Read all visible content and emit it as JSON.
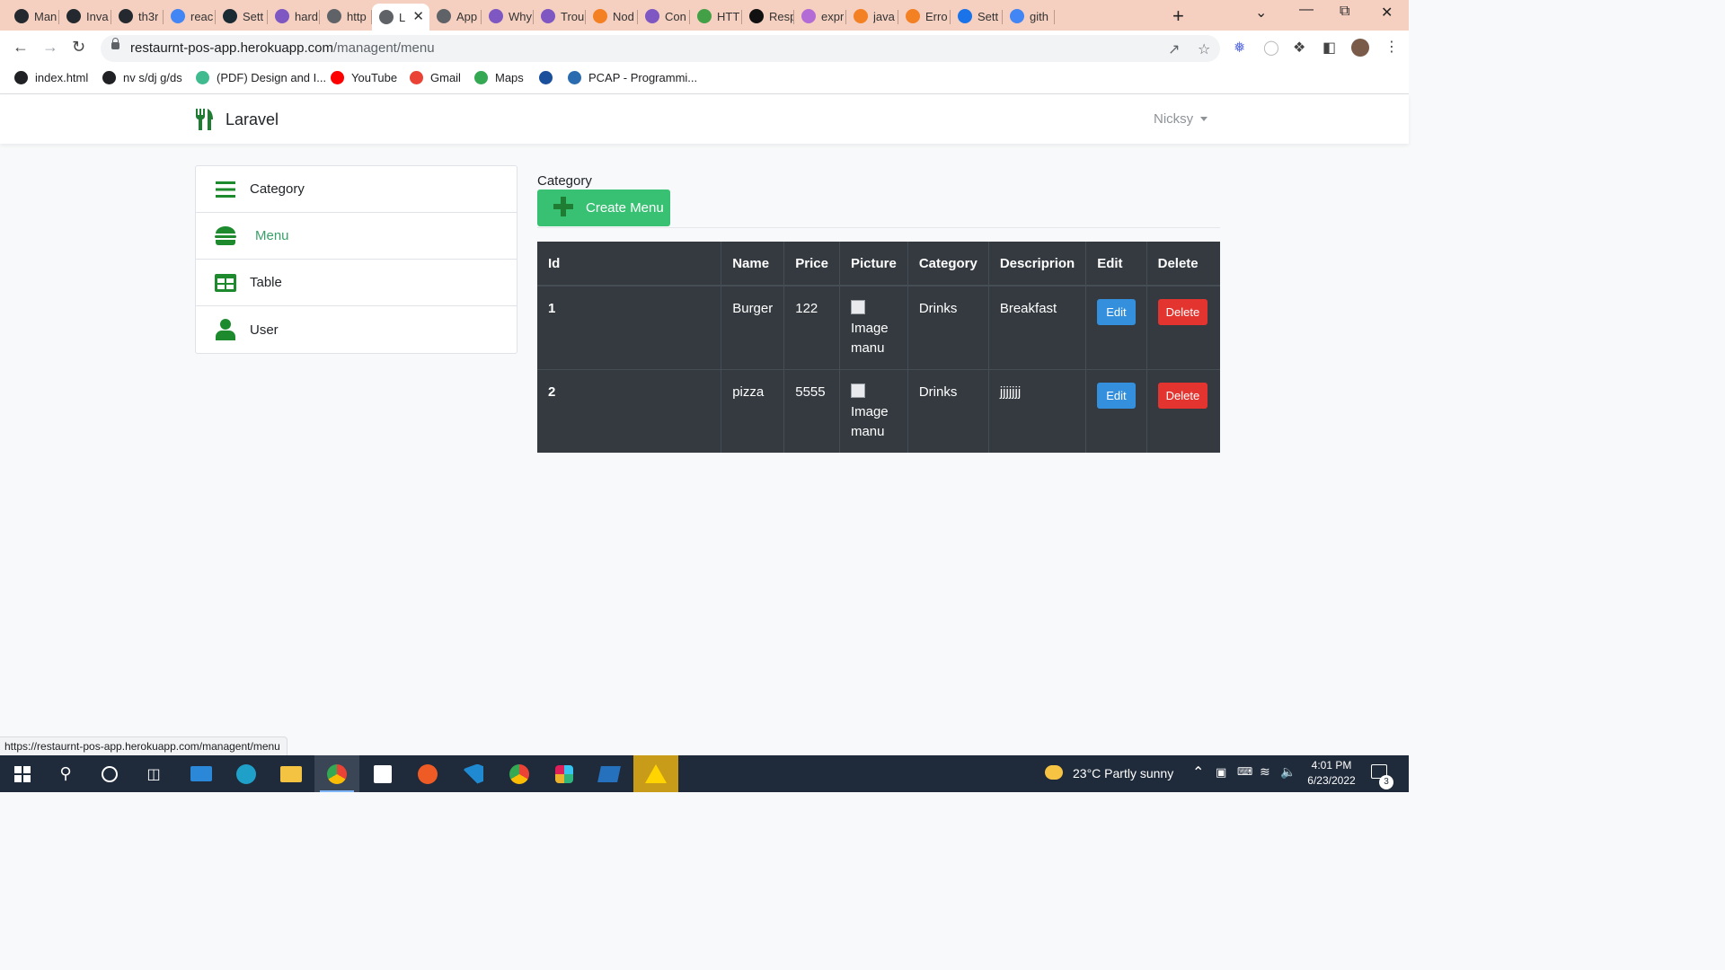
{
  "browser": {
    "tabs": [
      {
        "title": "Man",
        "icon": "github-icon",
        "color": "#24292f"
      },
      {
        "title": "Inva",
        "icon": "github-icon",
        "color": "#24292f"
      },
      {
        "title": "th3r",
        "icon": "github-icon",
        "color": "#24292f"
      },
      {
        "title": "reac",
        "icon": "google-icon",
        "color": "#4285f4"
      },
      {
        "title": "Sett",
        "icon": "react-icon",
        "color": "#1b2b34"
      },
      {
        "title": "hard",
        "icon": "hashnode-icon",
        "color": "#7e57c2"
      },
      {
        "title": "http",
        "icon": "globe-icon",
        "color": "#5f6368"
      },
      {
        "title": "L",
        "icon": "globe-icon",
        "color": "#5f6368",
        "active": true
      },
      {
        "title": "App",
        "icon": "globe-icon",
        "color": "#5f6368"
      },
      {
        "title": "Why",
        "icon": "hashnode-icon",
        "color": "#7e57c2"
      },
      {
        "title": "Trou",
        "icon": "hashnode-icon",
        "color": "#7e57c2"
      },
      {
        "title": "Nod",
        "icon": "stackoverflow-icon",
        "color": "#f48024"
      },
      {
        "title": "Con",
        "icon": "hashnode-icon",
        "color": "#7e57c2"
      },
      {
        "title": "HTT",
        "icon": "node-icon",
        "color": "#43a047"
      },
      {
        "title": "Resp",
        "icon": "medium-icon",
        "color": "#111111"
      },
      {
        "title": "expr",
        "icon": "graphql-icon",
        "color": "#b36bd6"
      },
      {
        "title": "java",
        "icon": "stackoverflow-icon",
        "color": "#f48024"
      },
      {
        "title": "Erro",
        "icon": "stackoverflow-icon",
        "color": "#f48024"
      },
      {
        "title": "Sett",
        "icon": "gear-icon",
        "color": "#1a73e8"
      },
      {
        "title": "gith",
        "icon": "google-icon",
        "color": "#4285f4"
      }
    ],
    "url_host": "restaurnt-pos-app.herokuapp.com",
    "url_path": "/managent/menu",
    "bookmarks": [
      {
        "label": "index.html",
        "color": "#202124"
      },
      {
        "label": "nv s/dj g/ds",
        "color": "#202124"
      },
      {
        "label": "(PDF) Design and I...",
        "color": "#40ba8f"
      },
      {
        "label": "YouTube",
        "color": "#ff0000"
      },
      {
        "label": "Gmail",
        "color": "#ea4335"
      },
      {
        "label": "Maps",
        "color": "#34a853"
      },
      {
        "label": "",
        "color": "#1a4f9c"
      },
      {
        "label": "PCAP - Programmi...",
        "color": "#2b6cb0"
      }
    ],
    "status_url": "https://restaurnt-pos-app.herokuapp.com/managent/menu"
  },
  "app": {
    "brand": "Laravel",
    "user": "Nicksy",
    "accent": "#38a169"
  },
  "sidebar": {
    "items": [
      {
        "label": "Category",
        "icon": "list-icon"
      },
      {
        "label": "Menu",
        "icon": "burger-icon",
        "active": true
      },
      {
        "label": "Table",
        "icon": "table-icon"
      },
      {
        "label": "User",
        "icon": "user-icon"
      }
    ]
  },
  "main": {
    "section_title": "Category",
    "create_label": "Create Menu",
    "columns": [
      "Id",
      "Name",
      "Price",
      "Picture",
      "Category",
      "Descriprion",
      "Edit",
      "Delete"
    ],
    "rows": [
      {
        "id": "1",
        "name": "Burger",
        "price": "122",
        "picture_alt": "Image manu",
        "category": "Drinks",
        "description": "Breakfast",
        "edit": "Edit",
        "delete": "Delete"
      },
      {
        "id": "2",
        "name": "pizza",
        "price": "5555",
        "picture_alt": "Image manu",
        "category": "Drinks",
        "description": "jjjjjjj",
        "edit": "Edit",
        "delete": "Delete"
      }
    ]
  },
  "taskbar": {
    "weather": "23°C  Partly sunny",
    "time": "4:01 PM",
    "date": "6/23/2022",
    "notifications": "3"
  }
}
